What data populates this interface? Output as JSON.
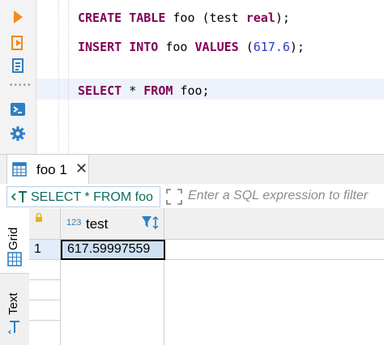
{
  "editor": {
    "lines": [
      {
        "parts": [
          {
            "t": "CREATE",
            "c": "kw"
          },
          {
            "t": " "
          },
          {
            "t": "TABLE",
            "c": "kw"
          },
          {
            "t": " foo (test "
          },
          {
            "t": "real",
            "c": "kw"
          },
          {
            "t": ");"
          }
        ]
      },
      {
        "parts": [
          {
            "t": "INSERT",
            "c": "kw"
          },
          {
            "t": " "
          },
          {
            "t": "INTO",
            "c": "kw"
          },
          {
            "t": " foo "
          },
          {
            "t": "VALUES",
            "c": "kw"
          },
          {
            "t": " ("
          },
          {
            "t": "617.6",
            "c": "num"
          },
          {
            "t": ");"
          }
        ]
      },
      {
        "parts": [
          {
            "t": "SELECT",
            "c": "kw"
          },
          {
            "t": " * "
          },
          {
            "t": "FROM",
            "c": "kw"
          },
          {
            "t": " foo;"
          }
        ]
      }
    ]
  },
  "gutter_icons": [
    "execute-icon",
    "execute-script-icon",
    "explain-plan-icon",
    "console-icon",
    "settings-icon"
  ],
  "result_tab": {
    "label": "foo 1",
    "close": "✕"
  },
  "filter": {
    "query": "SELECT * FROM foo",
    "placeholder": "Enter a SQL expression to filter"
  },
  "side_tabs": {
    "grid": "Grid",
    "text": "Text"
  },
  "table": {
    "columns": [
      {
        "type_badge": "123",
        "name": "test"
      }
    ],
    "rows": [
      {
        "num": "1",
        "values": [
          "617.59997559"
        ]
      }
    ]
  },
  "colors": {
    "keyword": "#7f0055",
    "number": "#2a35c8",
    "selection": "#cfe0f5"
  }
}
